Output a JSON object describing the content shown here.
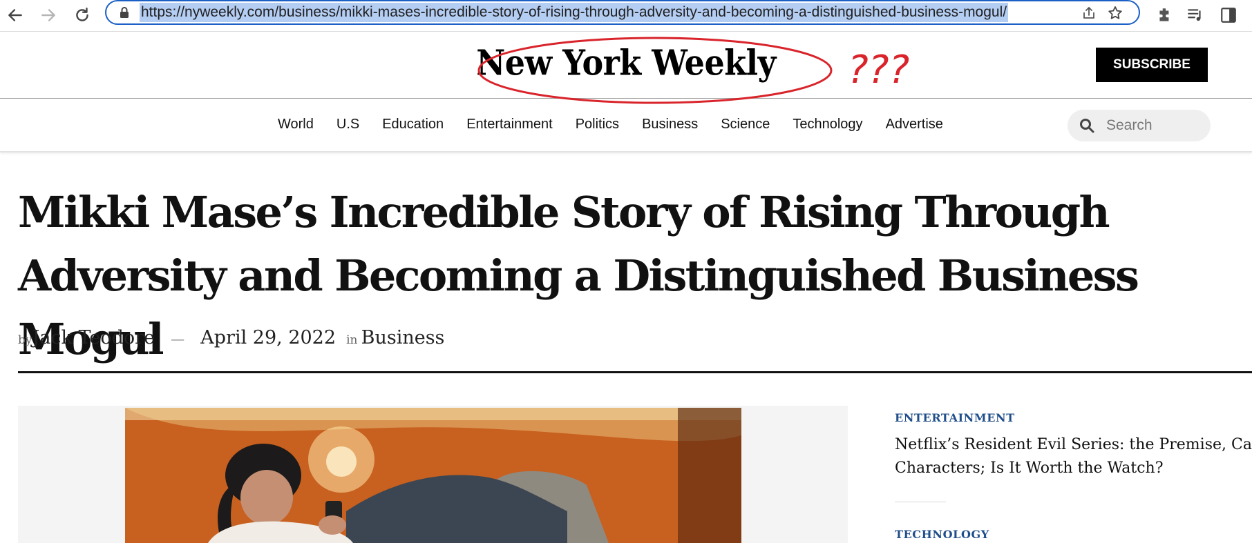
{
  "browser": {
    "url": "https://nyweekly.com/business/mikki-mases-incredible-story-of-rising-through-adversity-and-becoming-a-distinguished-business-mogul/"
  },
  "masthead": {
    "logo": "New York Weekly",
    "annotation": "???",
    "subscribe_label": "SUBSCRIBE"
  },
  "nav": {
    "items": [
      "World",
      "U.S",
      "Education",
      "Entertainment",
      "Politics",
      "Business",
      "Science",
      "Technology",
      "Advertise"
    ],
    "search_placeholder": "Search"
  },
  "article": {
    "title": "Mikki Mase’s Incredible Story of Rising Through Adversity and Becoming a Distinguished Business Mogul",
    "by_label": "by",
    "author": "Jack Teodore",
    "separator": "—",
    "date": "April 29, 2022",
    "in_label": "in",
    "category": "Business"
  },
  "sidebar": {
    "items": [
      {
        "category": "ENTERTAINMENT",
        "title_line1": "Netflix’s Resident Evil Series: the Premise, Cast, and",
        "title_line2": "Characters; Is It Worth the Watch?"
      },
      {
        "category": "TECHNOLOGY"
      }
    ]
  },
  "colors": {
    "url_highlight": "#b4cdf2",
    "omnibox_border": "#1a5fc6",
    "annotation": "#d9242b",
    "sidebar_category": "#1f4e8a",
    "subscribe_bg": "#000000"
  }
}
